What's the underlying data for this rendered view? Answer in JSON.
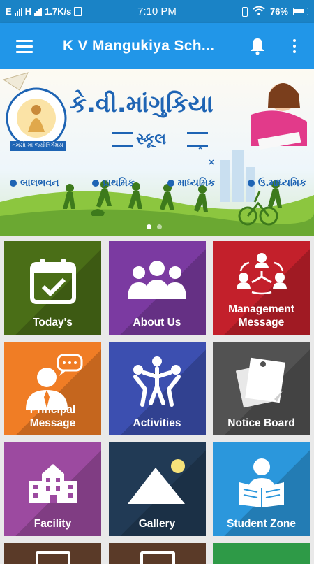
{
  "status_bar": {
    "left_text": "1.7K/s",
    "time": "7:10 PM",
    "battery": "76%"
  },
  "app_bar": {
    "title": "K V Mangukiya Sch..."
  },
  "banner": {
    "school_name": "કે.વી.માંગુકિયા",
    "school_sub": "સ્કૂલ",
    "levels": [
      "બાલભવન",
      "પ્રાથમિક",
      "માધ્યમિક",
      "ઉ.માધ્યમિક"
    ],
    "motto": "તમસો મા જ્યોતિર્ગમય"
  },
  "tiles": [
    {
      "label": "Today's",
      "color": "#4a6e17",
      "icon": "calendar-check-icon"
    },
    {
      "label": "About Us",
      "color": "#7b3aa1",
      "icon": "group-people-icon"
    },
    {
      "label": "Management\nMessage",
      "color": "#c3202b",
      "icon": "management-network-icon"
    },
    {
      "label": "Principal Message",
      "color": "#f07d25",
      "icon": "person-speech-icon"
    },
    {
      "label": "Activities",
      "color": "#3c4fb0",
      "icon": "activities-people-icon"
    },
    {
      "label": "Notice Board",
      "color": "#525252",
      "icon": "notice-paper-icon"
    },
    {
      "label": "Facility",
      "color": "#9c4aa0",
      "icon": "building-icon"
    },
    {
      "label": "Gallery",
      "color": "#213a55",
      "icon": "mountain-sun-icon"
    },
    {
      "label": "Student Zone",
      "color": "#2b97dc",
      "icon": "student-reading-icon"
    }
  ],
  "partial_tiles": [
    {
      "color": "#5a3a28"
    },
    {
      "color": "#5a3a28"
    },
    {
      "color": "#2e9a47"
    }
  ]
}
